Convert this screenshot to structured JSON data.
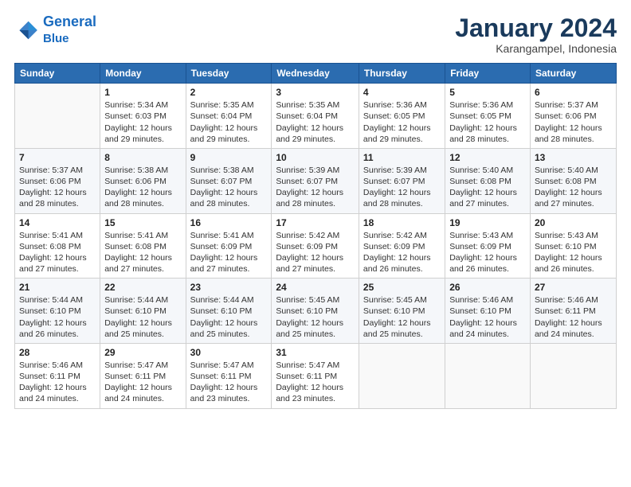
{
  "header": {
    "logo_line1": "General",
    "logo_line2": "Blue",
    "title": "January 2024",
    "subtitle": "Karangampel, Indonesia"
  },
  "columns": [
    "Sunday",
    "Monday",
    "Tuesday",
    "Wednesday",
    "Thursday",
    "Friday",
    "Saturday"
  ],
  "weeks": [
    [
      {
        "day": "",
        "info": ""
      },
      {
        "day": "1",
        "info": "Sunrise: 5:34 AM\nSunset: 6:03 PM\nDaylight: 12 hours\nand 29 minutes."
      },
      {
        "day": "2",
        "info": "Sunrise: 5:35 AM\nSunset: 6:04 PM\nDaylight: 12 hours\nand 29 minutes."
      },
      {
        "day": "3",
        "info": "Sunrise: 5:35 AM\nSunset: 6:04 PM\nDaylight: 12 hours\nand 29 minutes."
      },
      {
        "day": "4",
        "info": "Sunrise: 5:36 AM\nSunset: 6:05 PM\nDaylight: 12 hours\nand 29 minutes."
      },
      {
        "day": "5",
        "info": "Sunrise: 5:36 AM\nSunset: 6:05 PM\nDaylight: 12 hours\nand 28 minutes."
      },
      {
        "day": "6",
        "info": "Sunrise: 5:37 AM\nSunset: 6:06 PM\nDaylight: 12 hours\nand 28 minutes."
      }
    ],
    [
      {
        "day": "7",
        "info": "Sunrise: 5:37 AM\nSunset: 6:06 PM\nDaylight: 12 hours\nand 28 minutes."
      },
      {
        "day": "8",
        "info": "Sunrise: 5:38 AM\nSunset: 6:06 PM\nDaylight: 12 hours\nand 28 minutes."
      },
      {
        "day": "9",
        "info": "Sunrise: 5:38 AM\nSunset: 6:07 PM\nDaylight: 12 hours\nand 28 minutes."
      },
      {
        "day": "10",
        "info": "Sunrise: 5:39 AM\nSunset: 6:07 PM\nDaylight: 12 hours\nand 28 minutes."
      },
      {
        "day": "11",
        "info": "Sunrise: 5:39 AM\nSunset: 6:07 PM\nDaylight: 12 hours\nand 28 minutes."
      },
      {
        "day": "12",
        "info": "Sunrise: 5:40 AM\nSunset: 6:08 PM\nDaylight: 12 hours\nand 27 minutes."
      },
      {
        "day": "13",
        "info": "Sunrise: 5:40 AM\nSunset: 6:08 PM\nDaylight: 12 hours\nand 27 minutes."
      }
    ],
    [
      {
        "day": "14",
        "info": "Sunrise: 5:41 AM\nSunset: 6:08 PM\nDaylight: 12 hours\nand 27 minutes."
      },
      {
        "day": "15",
        "info": "Sunrise: 5:41 AM\nSunset: 6:08 PM\nDaylight: 12 hours\nand 27 minutes."
      },
      {
        "day": "16",
        "info": "Sunrise: 5:41 AM\nSunset: 6:09 PM\nDaylight: 12 hours\nand 27 minutes."
      },
      {
        "day": "17",
        "info": "Sunrise: 5:42 AM\nSunset: 6:09 PM\nDaylight: 12 hours\nand 27 minutes."
      },
      {
        "day": "18",
        "info": "Sunrise: 5:42 AM\nSunset: 6:09 PM\nDaylight: 12 hours\nand 26 minutes."
      },
      {
        "day": "19",
        "info": "Sunrise: 5:43 AM\nSunset: 6:09 PM\nDaylight: 12 hours\nand 26 minutes."
      },
      {
        "day": "20",
        "info": "Sunrise: 5:43 AM\nSunset: 6:10 PM\nDaylight: 12 hours\nand 26 minutes."
      }
    ],
    [
      {
        "day": "21",
        "info": "Sunrise: 5:44 AM\nSunset: 6:10 PM\nDaylight: 12 hours\nand 26 minutes."
      },
      {
        "day": "22",
        "info": "Sunrise: 5:44 AM\nSunset: 6:10 PM\nDaylight: 12 hours\nand 25 minutes."
      },
      {
        "day": "23",
        "info": "Sunrise: 5:44 AM\nSunset: 6:10 PM\nDaylight: 12 hours\nand 25 minutes."
      },
      {
        "day": "24",
        "info": "Sunrise: 5:45 AM\nSunset: 6:10 PM\nDaylight: 12 hours\nand 25 minutes."
      },
      {
        "day": "25",
        "info": "Sunrise: 5:45 AM\nSunset: 6:10 PM\nDaylight: 12 hours\nand 25 minutes."
      },
      {
        "day": "26",
        "info": "Sunrise: 5:46 AM\nSunset: 6:10 PM\nDaylight: 12 hours\nand 24 minutes."
      },
      {
        "day": "27",
        "info": "Sunrise: 5:46 AM\nSunset: 6:11 PM\nDaylight: 12 hours\nand 24 minutes."
      }
    ],
    [
      {
        "day": "28",
        "info": "Sunrise: 5:46 AM\nSunset: 6:11 PM\nDaylight: 12 hours\nand 24 minutes."
      },
      {
        "day": "29",
        "info": "Sunrise: 5:47 AM\nSunset: 6:11 PM\nDaylight: 12 hours\nand 24 minutes."
      },
      {
        "day": "30",
        "info": "Sunrise: 5:47 AM\nSunset: 6:11 PM\nDaylight: 12 hours\nand 23 minutes."
      },
      {
        "day": "31",
        "info": "Sunrise: 5:47 AM\nSunset: 6:11 PM\nDaylight: 12 hours\nand 23 minutes."
      },
      {
        "day": "",
        "info": ""
      },
      {
        "day": "",
        "info": ""
      },
      {
        "day": "",
        "info": ""
      }
    ]
  ]
}
